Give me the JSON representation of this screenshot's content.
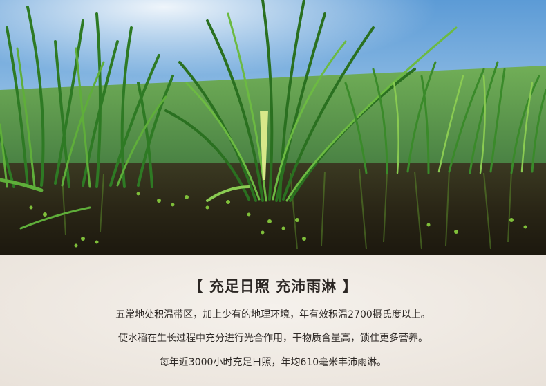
{
  "section": {
    "heading": "【 充足日照  充沛雨淋 】",
    "lines": [
      "五常地处积温带区，加上少有的地理环境，年有效积温2700摄氏度以上。",
      "使水稻在生长过程中充分进行光合作用，干物质含量高，锁住更多营养。",
      "每年近3000小时充足日照，年均610毫米丰沛雨淋。"
    ]
  },
  "colors": {
    "sky_top": "#6fa9dc",
    "sky_bottom": "#cfe4f3",
    "grass_dark": "#1f5a1c",
    "grass_light": "#7fc24a",
    "water": "#2a2418",
    "panel_bg": "#efe9e2",
    "text": "#2b2623"
  }
}
